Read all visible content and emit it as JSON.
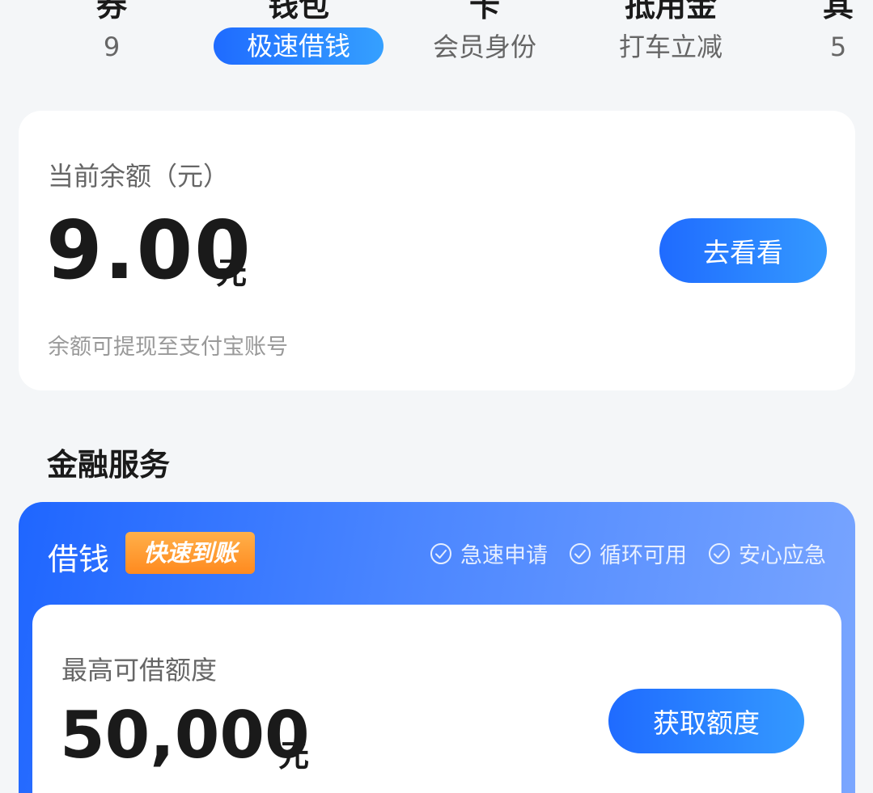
{
  "tabs": [
    {
      "title": "券",
      "sub": "9"
    },
    {
      "title": "钱包",
      "sub": "极速借钱"
    },
    {
      "title": "卡",
      "sub": "会员身份"
    },
    {
      "title": "抵用金",
      "sub": "打车立减"
    },
    {
      "title": "其",
      "sub": "5"
    }
  ],
  "balance": {
    "label": "当前余额（元）",
    "amount": "9.00",
    "unit": "元",
    "note": "余额可提现至支付宝账号",
    "button": "去看看"
  },
  "section_title": "金融服务",
  "loan": {
    "title": "借钱",
    "badge": "快速到账",
    "features": [
      "急速申请",
      "循环可用",
      "安心应急"
    ],
    "label": "最高可借额度",
    "amount": "50,000",
    "unit": "元",
    "button": "获取额度"
  },
  "colors": {
    "accent": "#1f6bff",
    "badge": "#ff8a1f"
  },
  "icons": {
    "feature_check": "check-circle-icon"
  }
}
